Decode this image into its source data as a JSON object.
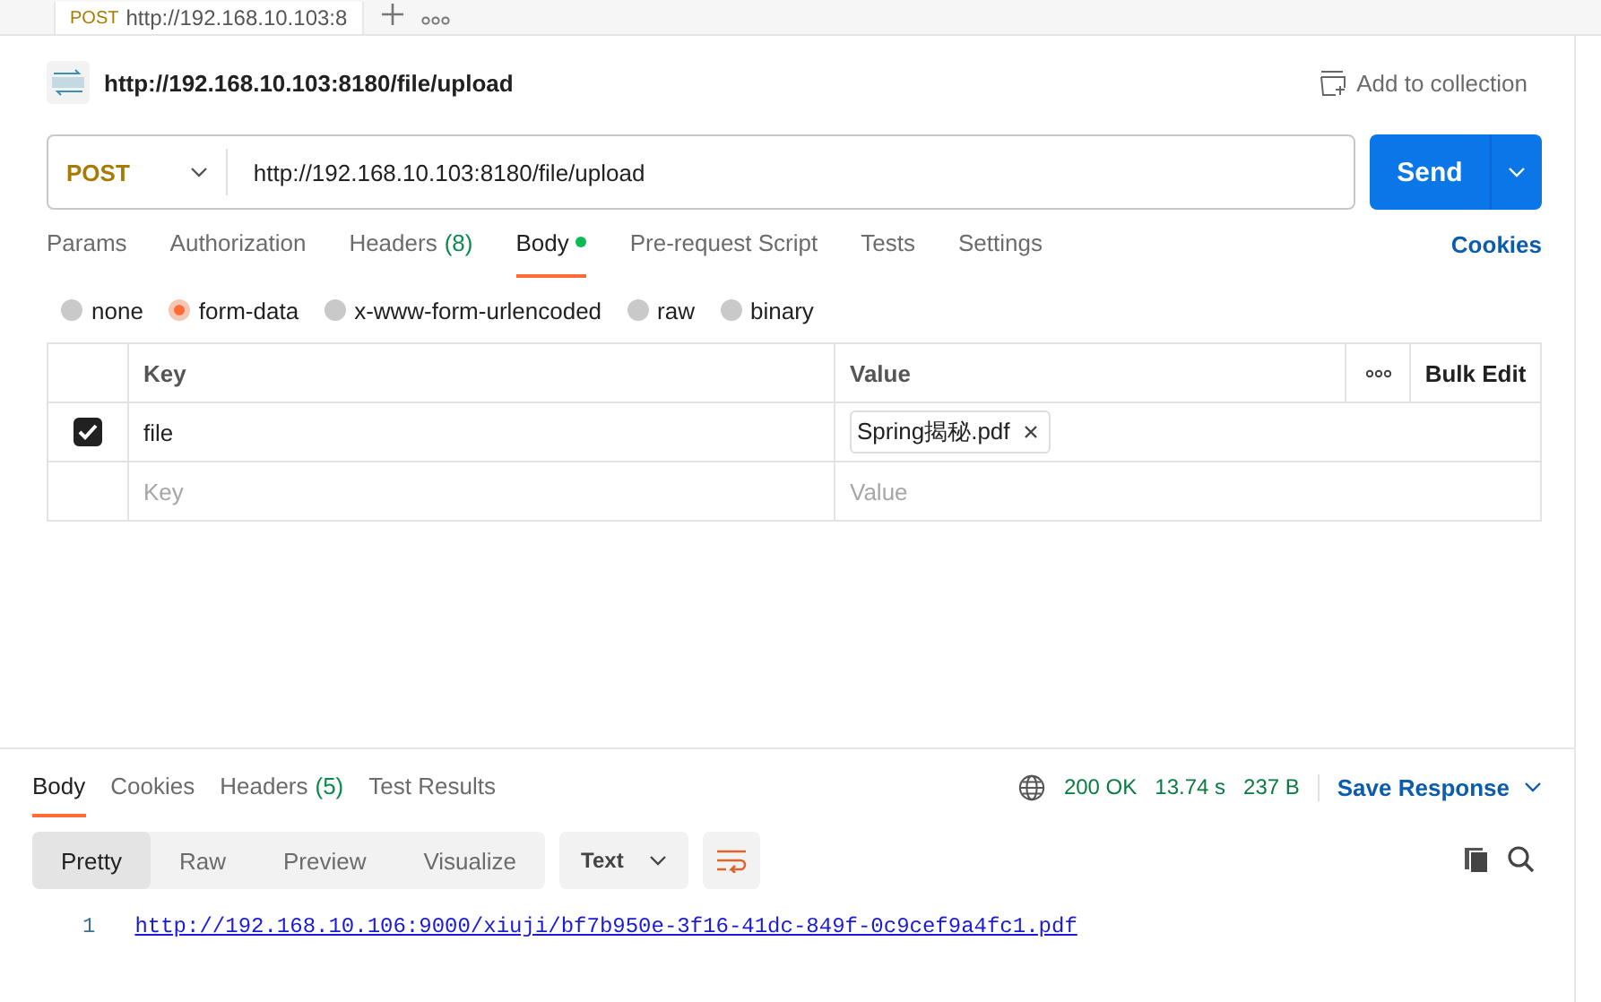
{
  "tab_strip": {
    "tabs": [
      {
        "method": "POST",
        "title": "http://192.168.10.103:8",
        "selected": true
      }
    ]
  },
  "request": {
    "title": "http://192.168.10.103:8180/file/upload",
    "add_to_collection": "Add to collection",
    "method": "POST",
    "url": "http://192.168.10.103:8180/file/upload",
    "send": "Send",
    "tabs": [
      {
        "label": "Params",
        "selected": false
      },
      {
        "label": "Authorization",
        "selected": false
      },
      {
        "label": "Headers",
        "count": "(8)",
        "selected": false
      },
      {
        "label": "Body",
        "indicator": true,
        "selected": true
      },
      {
        "label": "Pre-request Script",
        "selected": false
      },
      {
        "label": "Tests",
        "selected": false
      },
      {
        "label": "Settings",
        "selected": false
      }
    ],
    "cookies": "Cookies",
    "body_types": [
      {
        "label": "none",
        "selected": false
      },
      {
        "label": "form-data",
        "selected": true
      },
      {
        "label": "x-www-form-urlencoded",
        "selected": false
      },
      {
        "label": "raw",
        "selected": false
      },
      {
        "label": "binary",
        "selected": false
      }
    ],
    "params": {
      "columns": [
        "Key",
        "Value"
      ],
      "bulk_edit": "Bulk Edit",
      "rows": [
        {
          "kind": "file",
          "checked": true,
          "key": "file",
          "value": "Spring揭秘.pdf"
        }
      ],
      "new_row": {
        "key_placeholder": "Key",
        "value_placeholder": "Value"
      }
    }
  },
  "response": {
    "tabs": [
      {
        "label": "Body",
        "selected": true
      },
      {
        "label": "Cookies",
        "selected": false
      },
      {
        "label": "Headers",
        "count": "(5)",
        "selected": false
      },
      {
        "label": "Test Results",
        "selected": false
      }
    ],
    "status": "200 OK",
    "time": "13.74 s",
    "size": "237 B",
    "save": "Save Response",
    "view_modes": [
      {
        "label": "Pretty",
        "selected": true
      },
      {
        "label": "Raw",
        "selected": false
      },
      {
        "label": "Preview",
        "selected": false
      },
      {
        "label": "Visualize",
        "selected": false
      }
    ],
    "format": "Text",
    "lines": [
      {
        "number": "1",
        "text": "http://192.168.10.106:9000/xiuji/bf7b950e-3f16-41dc-849f-0c9cef9a4fc1.pdf"
      }
    ]
  }
}
